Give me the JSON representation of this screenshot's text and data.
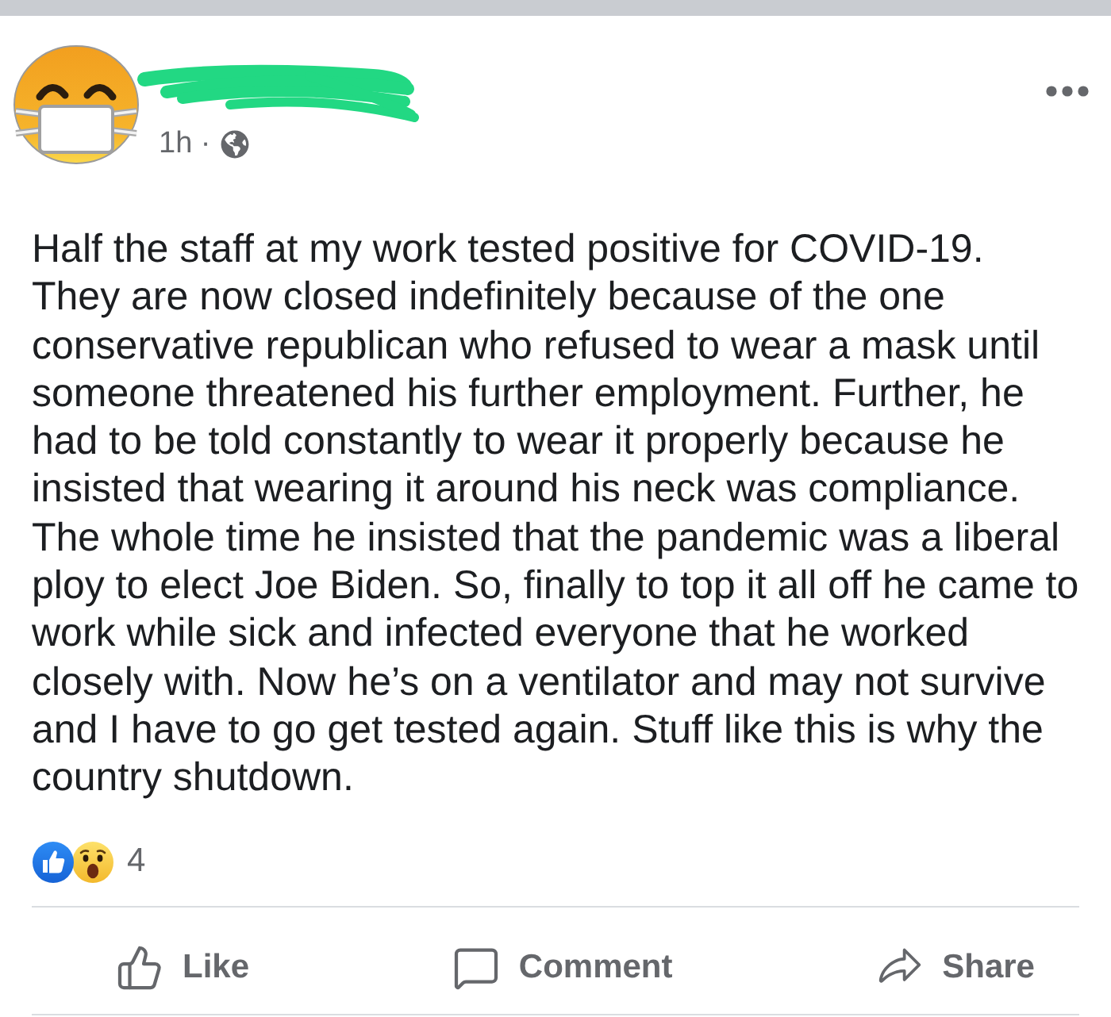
{
  "post": {
    "author": {
      "name_redacted": true
    },
    "meta": "1h ·",
    "body": "Half the staff at my work tested positive for COVID-19. They are now closed indefinitely because of the one conservative republican who refused to wear a mask until someone threatened his further employment. Further, he had to be told constantly to wear it properly because he insisted that wearing it around his neck was compliance. The whole time he insisted that the pandemic was a liberal ploy to elect Joe Biden. So, finally to top it all off he came to work while sick and infected everyone that he worked closely with. Now he’s on a ventilator and may not survive and I have to go get tested again. Stuff like this is why the country shutdown.",
    "reactions": {
      "types": [
        {
          "kind": "like"
        },
        {
          "kind": "wow"
        }
      ],
      "count": "4"
    },
    "actions": [
      {
        "kind": "like",
        "label": "Like"
      },
      {
        "kind": "comment",
        "label": "Comment"
      },
      {
        "kind": "share",
        "label": "Share"
      }
    ]
  }
}
